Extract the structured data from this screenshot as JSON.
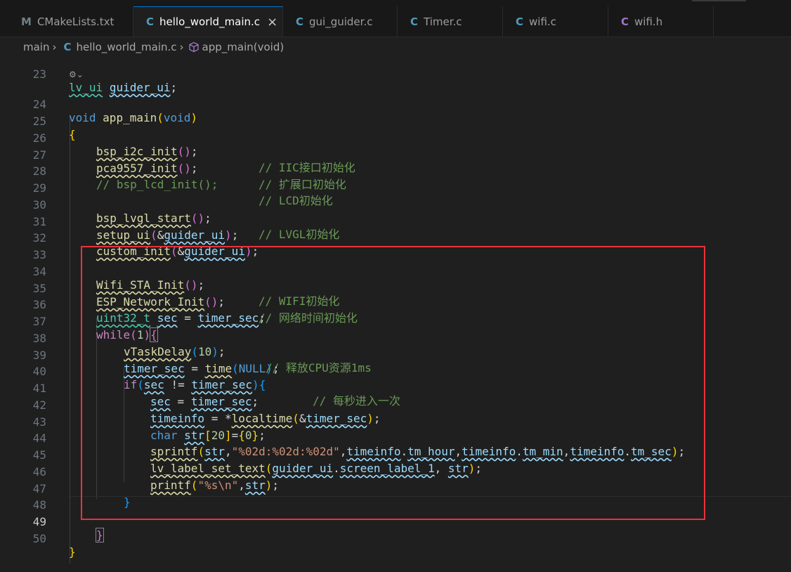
{
  "tabs": [
    {
      "icon": "M",
      "label": "CMakeLists.txt",
      "color": "#6d8086"
    },
    {
      "icon": "C",
      "label": "hello_world_main.c",
      "color": "#519aba",
      "active": true
    },
    {
      "icon": "C",
      "label": "gui_guider.c",
      "color": "#519aba"
    },
    {
      "icon": "C",
      "label": "Timer.c",
      "color": "#519aba"
    },
    {
      "icon": "C",
      "label": "wifi.c",
      "color": "#519aba"
    },
    {
      "icon": "C",
      "label": "wifi.h",
      "color": "#a074c4"
    }
  ],
  "close_glyph": "×",
  "breadcrumb": {
    "folder": "main",
    "file_icon": "C",
    "file": "hello_world_main.c",
    "symbol": "app_main(void)"
  },
  "codelens": "⚙︎⌄",
  "line_numbers": [
    "23",
    "24",
    "25",
    "26",
    "27",
    "28",
    "29",
    "30",
    "31",
    "32",
    "33",
    "34",
    "35",
    "36",
    "37",
    "38",
    "39",
    "40",
    "41",
    "42",
    "43",
    "44",
    "45",
    "46",
    "47",
    "48",
    "49",
    "50"
  ],
  "code": {
    "l23": {
      "a": "lv_ui",
      "b": "guider_ui",
      "c": ";"
    },
    "l24": {
      "a": "void",
      "b": "app_main",
      "c": "(",
      "d": "void",
      "e": ")"
    },
    "l25": {
      "a": "{"
    },
    "l26": {
      "a": "bsp_i2c_init",
      "b": "()",
      "c": ";",
      "d": "// IIC接口初始化"
    },
    "l27": {
      "a": "pca9557_init",
      "b": "()",
      "c": ";",
      "d": "// 扩展口初始化"
    },
    "l28": {
      "a": "// bsp_lcd_init();",
      "d": "// LCD初始化"
    },
    "l30": {
      "a": "bsp_lvgl_start",
      "b": "()",
      "c": ";",
      "d": "// LVGL初始化"
    },
    "l31": {
      "a": "setup_ui",
      "b": "(",
      "c": "&",
      "d": "guider_ui",
      "e": ")",
      "f": ";"
    },
    "l32": {
      "a": "custom_init",
      "b": "(",
      "c": "&",
      "d": "guider_ui",
      "e": ")",
      "f": ";"
    },
    "l34": {
      "a": "Wifi_STA_Init",
      "b": "()",
      "c": ";",
      "d": "// WIFI初始化"
    },
    "l35": {
      "a": "ESP_Network_Init",
      "b": "()",
      "c": ";",
      "d": "// 网络时间初始化"
    },
    "l36": {
      "a": "uint32_t",
      "b": "sec",
      "c": " = ",
      "d": "timer_sec",
      "e": ";"
    },
    "l37": {
      "a": "while",
      "b": "(",
      "c": "1",
      "d": ")",
      "e": "{"
    },
    "l38": {
      "a": "vTaskDelay",
      "b": "(",
      "c": "10",
      "d": ")",
      "e": ";",
      "f": "// 释放CPU资源1ms"
    },
    "l39": {
      "a": "timer_sec",
      "b": " = ",
      "c": "time",
      "d": "(",
      "e": "NULL",
      "f": ")",
      "g": ";"
    },
    "l40": {
      "a": "if",
      "b": "(",
      "c": "sec",
      "d": " != ",
      "e": "timer_sec",
      "f": ")",
      "g": "{",
      "h": "// 每秒进入一次"
    },
    "l41": {
      "a": "sec",
      "b": " = ",
      "c": "timer_sec",
      "d": ";"
    },
    "l42": {
      "a": "timeinfo",
      "b": " = *",
      "c": "localtime",
      "d": "(",
      "e": "&",
      "f": "timer_sec",
      "g": ")",
      "h": ";"
    },
    "l43": {
      "a": "char",
      "b": "str",
      "c": "[",
      "d": "20",
      "e": "]",
      "f": "=",
      "g": "{",
      "h": "0",
      "i": "}",
      "j": ";"
    },
    "l44": {
      "a": "sprintf",
      "b": "(",
      "c": "str",
      "d": ",",
      "e": "\"%02d:%02d:%02d\"",
      "f": ",",
      "g": "timeinfo",
      "h": ".",
      "i": "tm_hour",
      "j": ",",
      "k": "timeinfo",
      "l": ".",
      "m": "tm_min",
      "n": ",",
      "o": "timeinfo",
      "p": ".",
      "q": "tm_sec",
      "r": ")",
      "s": ";"
    },
    "l45": {
      "a": "lv_label_set_text",
      "b": "(",
      "c": "guider_ui",
      "d": ".",
      "e": "screen_label_1",
      "f": ", ",
      "g": "str",
      "h": ")",
      "i": ";"
    },
    "l46": {
      "a": "printf",
      "b": "(",
      "c": "\"%s\\n\"",
      "d": ",",
      "e": "str",
      "f": ")",
      "g": ";"
    },
    "l47": {
      "a": "}"
    },
    "l49": {
      "a": "}"
    },
    "l50": {
      "a": "}"
    }
  },
  "colors": {
    "highlight_box": "#e8333a",
    "accent": "#0078d4"
  }
}
